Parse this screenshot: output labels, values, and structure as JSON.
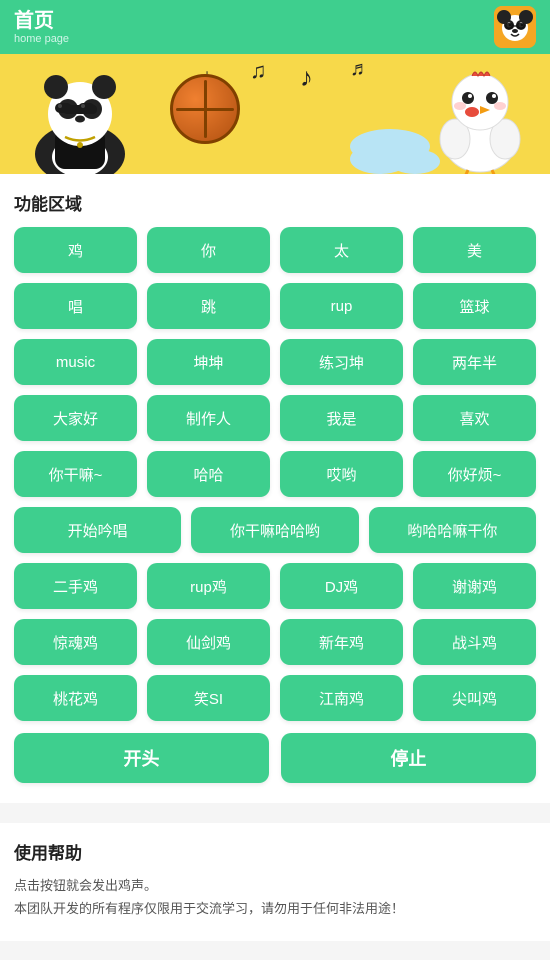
{
  "header": {
    "title": "首页",
    "subtitle": "home page",
    "avatar_emoji": "🐼"
  },
  "banner": {
    "notes": [
      "♩",
      "♪",
      "♫",
      "♬"
    ]
  },
  "function_area": {
    "title": "功能区域",
    "buttons": [
      {
        "label": "鸡",
        "size": "normal"
      },
      {
        "label": "你",
        "size": "normal"
      },
      {
        "label": "太",
        "size": "normal"
      },
      {
        "label": "美",
        "size": "normal"
      },
      {
        "label": "唱",
        "size": "normal"
      },
      {
        "label": "跳",
        "size": "normal"
      },
      {
        "label": "rup",
        "size": "normal"
      },
      {
        "label": "篮球",
        "size": "normal"
      },
      {
        "label": "music",
        "size": "normal"
      },
      {
        "label": "坤坤",
        "size": "normal"
      },
      {
        "label": "练习坤",
        "size": "normal"
      },
      {
        "label": "两年半",
        "size": "normal"
      },
      {
        "label": "大家好",
        "size": "normal"
      },
      {
        "label": "制作人",
        "size": "normal"
      },
      {
        "label": "我是",
        "size": "normal"
      },
      {
        "label": "喜欢",
        "size": "normal"
      },
      {
        "label": "你干嘛~",
        "size": "normal"
      },
      {
        "label": "哈哈",
        "size": "normal"
      },
      {
        "label": "哎哟",
        "size": "normal"
      },
      {
        "label": "你好烦~",
        "size": "normal"
      },
      {
        "label": "开始吟唱",
        "size": "wide"
      },
      {
        "label": "你干嘛哈哈哟",
        "size": "wide"
      },
      {
        "label": "哟哈哈嘛干你",
        "size": "wide"
      },
      {
        "label": "二手鸡",
        "size": "normal"
      },
      {
        "label": "rup鸡",
        "size": "normal"
      },
      {
        "label": "DJ鸡",
        "size": "normal"
      },
      {
        "label": "谢谢鸡",
        "size": "normal"
      },
      {
        "label": "惊魂鸡",
        "size": "normal"
      },
      {
        "label": "仙剑鸡",
        "size": "normal"
      },
      {
        "label": "新年鸡",
        "size": "normal"
      },
      {
        "label": "战斗鸡",
        "size": "normal"
      },
      {
        "label": "桃花鸡",
        "size": "normal"
      },
      {
        "label": "笑SI",
        "size": "normal"
      },
      {
        "label": "江南鸡",
        "size": "normal"
      },
      {
        "label": "尖叫鸡",
        "size": "normal"
      }
    ],
    "start_label": "开头",
    "stop_label": "停止"
  },
  "help": {
    "title": "使用帮助",
    "line1": "点击按钮就会发出鸡声。",
    "line2": "本团队开发的所有程序仅限用于交流学习，请勿用于任何非法用途！"
  }
}
